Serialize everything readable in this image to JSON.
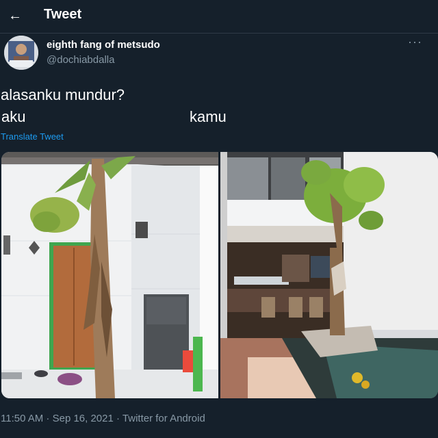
{
  "header": {
    "back_icon": "arrow-left-icon",
    "title": "Tweet"
  },
  "author": {
    "display_name": "eighth fang of metsudo",
    "handle": "@dochiabdalla"
  },
  "more_icon": "ellipsis-icon",
  "more_text": "···",
  "tweet": {
    "line1": "alasanku mundur?",
    "label_left": "aku",
    "label_right": "kamu",
    "translate": "Translate Tweet"
  },
  "footer": {
    "timestamp": "11:50 AM · Sep 16, 2021 · Twitter for Android"
  },
  "colors": {
    "background": "#15202b",
    "text": "#ffffff",
    "muted": "#8899a6",
    "link": "#1d9bf0"
  }
}
